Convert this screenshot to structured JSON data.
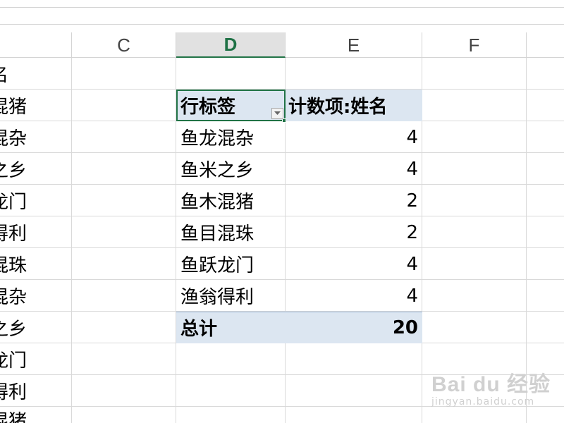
{
  "columns": [
    "C",
    "D",
    "E",
    "F"
  ],
  "left_column_cells": [
    "名",
    "混猪",
    "混杂",
    "之乡",
    "龙门",
    "得利",
    "混珠",
    "混杂",
    "之乡",
    "龙门",
    "得利",
    "混猪"
  ],
  "pivot": {
    "row_label_header": "行标签",
    "count_header": "计数项:姓名",
    "rows": [
      {
        "label": "鱼龙混杂",
        "count": "4"
      },
      {
        "label": "鱼米之乡",
        "count": "4"
      },
      {
        "label": "鱼木混猪",
        "count": "2"
      },
      {
        "label": "鱼目混珠",
        "count": "2"
      },
      {
        "label": "鱼跃龙门",
        "count": "4"
      },
      {
        "label": "渔翁得利",
        "count": "4"
      }
    ],
    "total_label": "总计",
    "total_value": "20"
  },
  "filter_dropdown_icon": "chevron-down-icon",
  "watermark": {
    "logo": "Bai du 经验",
    "sub": "jingyan.baidu.com"
  },
  "colors": {
    "accent": "#217346",
    "pivot_band": "#dce6f1",
    "header_selected": "#e1e1e1"
  }
}
